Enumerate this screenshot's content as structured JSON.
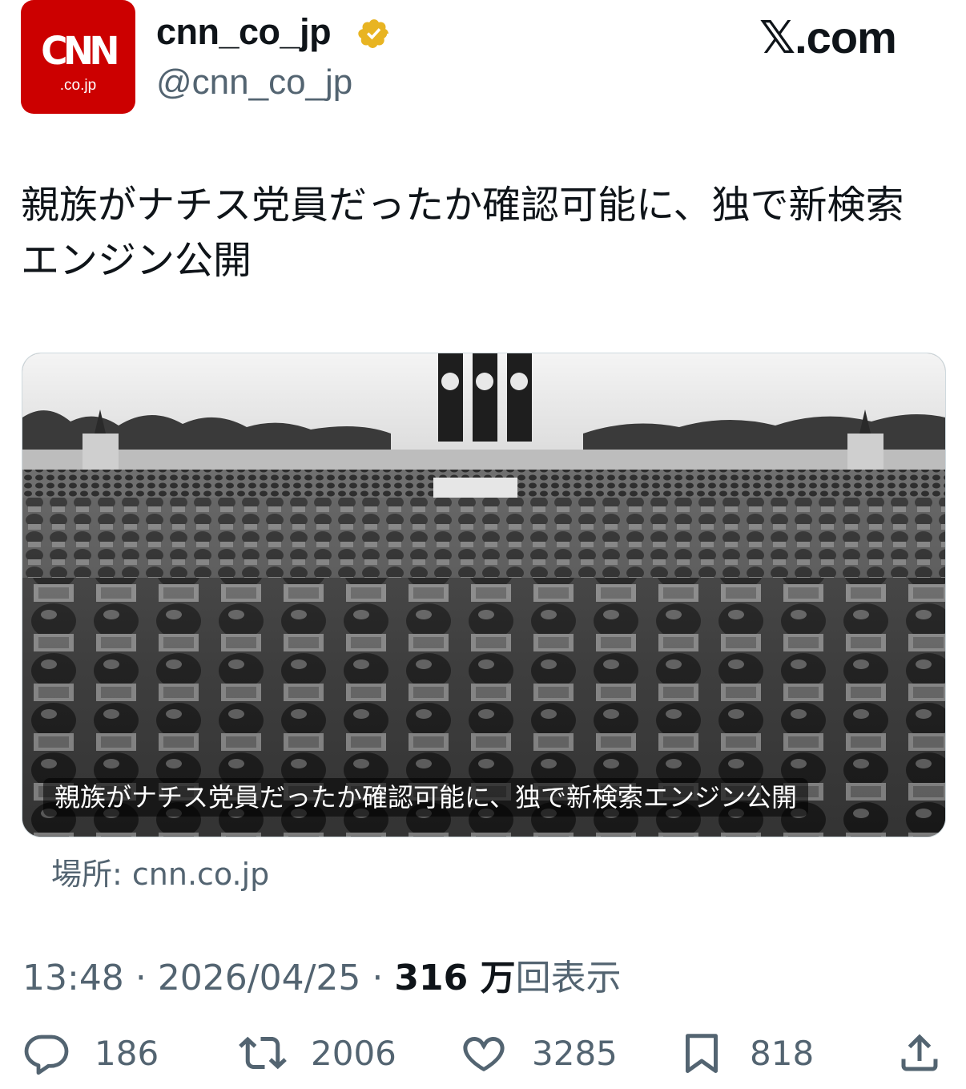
{
  "author": {
    "logo_text": "CNN",
    "logo_subtext": ".co.jp",
    "display_name": "cnn_co_jp",
    "handle": "@cnn_co_jp",
    "verified_icon": "gold-verified-badge"
  },
  "brand": "𝕏.com",
  "tweet": {
    "text": "親族がナチス党員だったか確認可能に、独で新検索エンジン公開"
  },
  "card": {
    "caption": "親族がナチス党員だったか確認可能に、独で新検索エンジン公開",
    "image_icon": "rally-photo",
    "source": "場所: cnn.co.jp"
  },
  "meta": {
    "time": "13:48",
    "separator": "·",
    "date": "2026/04/25",
    "views_count": "316 万",
    "views_label": "回表示"
  },
  "actions": {
    "replies": "186",
    "retweets": "2006",
    "likes": "3285",
    "bookmarks": "818"
  },
  "colors": {
    "brand_red": "#cc0000",
    "verified_gold": "#e8b422",
    "secondary_text": "#536471",
    "primary_text": "#0f1419"
  }
}
